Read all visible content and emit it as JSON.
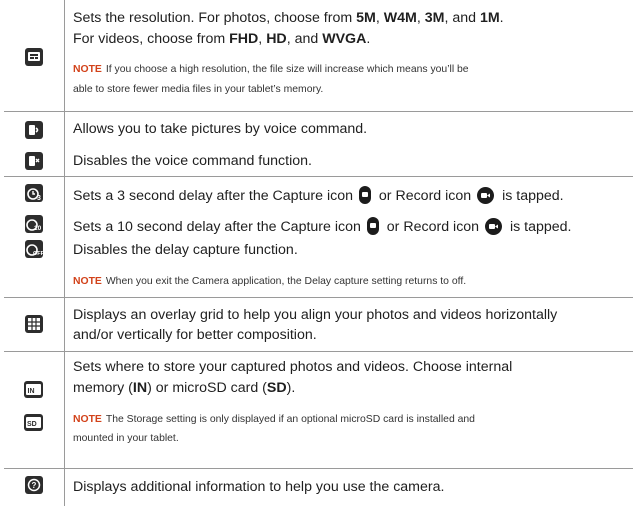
{
  "rows": {
    "resolution": {
      "line1_a": "Sets the resolution. For photos, choose from ",
      "v5m": "5M",
      "sep1": ", ",
      "vw4m": "W4M",
      "sep2": ", ",
      "v3m": "3M",
      "sep3": ", and ",
      "v1m": "1M",
      "end1": ".",
      "line2_a": "For videos, choose from ",
      "fhd": "FHD",
      "sep4": ", ",
      "hd": "HD",
      "sep5": ", and ",
      "wvga": "WVGA",
      "end2": ".",
      "note_label": "NOTE",
      "note_line1": "If you choose a high resolution, the file size will increase which means you’ll be",
      "note_line2": "able to store fewer media files in your tablet’s memory."
    },
    "voice": {
      "on_text": "Allows you to take pictures by voice command.",
      "off_text": "Disables the voice command function."
    },
    "timer": {
      "t3_a": "Sets a 3 second delay after the ",
      "capture": "Capture",
      "icon_word1": " icon ",
      "or": " or ",
      "record": "Record",
      "icon_word2": " icon ",
      "t3_end": " is tapped.",
      "t10_a": "Sets a 10 second delay after the ",
      "capture2": "Capture",
      "icon_word3": " icon ",
      "or2": " or ",
      "record2": "Record",
      "icon_word4": " icon ",
      "t10_end": " is tapped.",
      "off_text": "Disables the delay capture function.",
      "note_label": "NOTE",
      "note_text": "When you exit the Camera application, the Delay capture setting returns to off."
    },
    "grid": {
      "line1": "Displays an overlay grid to help you align your photos and videos horizontally",
      "line2": "and/or vertically for better composition."
    },
    "storage": {
      "line1": "Sets where to store your captured photos and videos. Choose internal",
      "line2_a": "memory (",
      "in": "IN",
      "line2_b": ") or microSD card (",
      "sd": "SD",
      "line2_c": ").",
      "note_label": "NOTE",
      "note_line1": "The Storage setting is only displayed if an optional microSD card is installed and",
      "note_line2": "mounted in your tablet.",
      "icon_in_label": "IN",
      "icon_sd_label": "SD"
    },
    "help": {
      "text": "Displays additional information to help you use the camera."
    }
  },
  "icons": {
    "resolution": "resolution-icon",
    "voice_on": "voice-shutter-on-icon",
    "voice_off": "voice-shutter-off-icon",
    "timer_3": "timer-3s-icon",
    "timer_10": "timer-10s-icon",
    "timer_off": "timer-off-icon",
    "grid": "grid-icon",
    "storage_in": "storage-internal-icon",
    "storage_sd": "storage-sd-icon",
    "help": "help-icon",
    "capture": "capture-button-icon",
    "record": "record-button-icon"
  },
  "colors": {
    "note": "#d2421a",
    "icon_bg": "#2d2d2d",
    "rule": "#9a9a9a"
  }
}
